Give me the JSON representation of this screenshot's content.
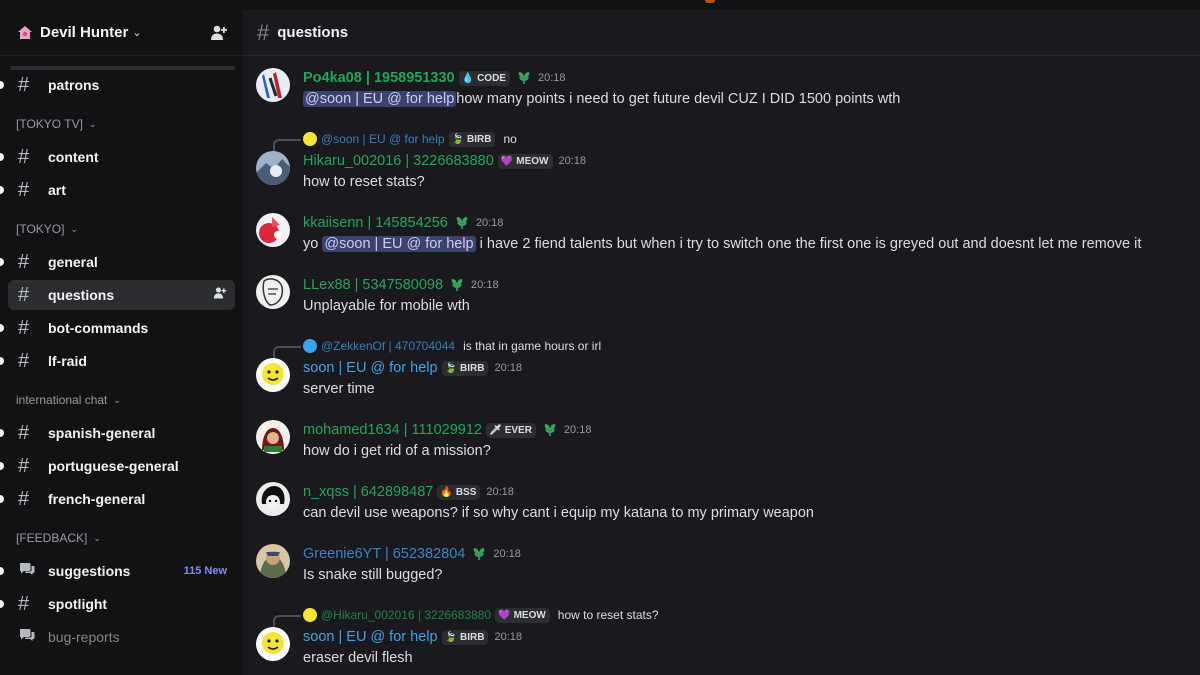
{
  "server": {
    "name": "Devil Hunter"
  },
  "sidebar": {
    "items": [
      {
        "type": "channel",
        "name": "patrons",
        "unread": true
      },
      {
        "type": "category",
        "name": "[TOKYO TV]"
      },
      {
        "type": "channel",
        "name": "content",
        "unread": true
      },
      {
        "type": "channel",
        "name": "art",
        "unread": true
      },
      {
        "type": "category",
        "name": "[TOKYO]"
      },
      {
        "type": "channel",
        "name": "general",
        "unread": true
      },
      {
        "type": "channel",
        "name": "questions",
        "active": true
      },
      {
        "type": "channel",
        "name": "bot-commands",
        "unread": true
      },
      {
        "type": "channel",
        "name": "lf-raid",
        "unread": true
      },
      {
        "type": "category",
        "name": "international chat"
      },
      {
        "type": "channel",
        "name": "spanish-general",
        "unread": true
      },
      {
        "type": "channel",
        "name": "portuguese-general",
        "unread": true
      },
      {
        "type": "channel",
        "name": "french-general",
        "unread": true
      },
      {
        "type": "category",
        "name": "[FEEDBACK]"
      },
      {
        "type": "forum",
        "name": "suggestions",
        "unread": true,
        "badge": "115 New"
      },
      {
        "type": "channel",
        "name": "spotlight",
        "unread": true
      },
      {
        "type": "forum",
        "name": "bug-reports",
        "muted": true
      }
    ]
  },
  "channel": {
    "name": "questions"
  },
  "messages": [
    {
      "user": "Po4ka08 | 1958951330",
      "name_color": "#23a55a",
      "tag": {
        "icon": "💧",
        "text": "CODE"
      },
      "leaf": true,
      "time": "20:18",
      "mention": "@soon | EU @ for help",
      "text": "how many points i need to get future devil CUZ I DID 1500 points wth",
      "avatar": "avatar-po4ka"
    },
    {
      "reply": {
        "name": "@soon | EU @ for help",
        "tag": "BIRB",
        "text": "no"
      },
      "user": "Hikaru_002016 | 3226683880",
      "name_color": "#23a55a",
      "tag": {
        "icon": "💜",
        "text": "MEOW"
      },
      "time": "20:18",
      "text": "how to reset stats?",
      "avatar": "avatar-hikaru"
    },
    {
      "user": "kkaiisenn | 145854256",
      "name_color": "#23a55a",
      "leaf": true,
      "time": "20:18",
      "text_before": "yo ",
      "mention": "@soon | EU @ for help",
      "text": " i have 2 fiend talents but when i try to switch one the first one is greyed out and doesnt let me remove it",
      "avatar": "avatar-kkaiisenn"
    },
    {
      "user": "LLex88 | 5347580098",
      "name_color": "#23a55a",
      "leaf": true,
      "time": "20:18",
      "text": "Unplayable for mobile wth",
      "avatar": "avatar-llex"
    },
    {
      "reply": {
        "name": "@ZekkenOf | 470704044",
        "text": "is that in game hours or irl"
      },
      "user": "soon | EU @ for help",
      "name_color": "#3ba3e8",
      "tag": {
        "icon": "🍃",
        "text": "BIRB"
      },
      "time": "20:18",
      "text": "server time",
      "avatar": "avatar-soon"
    },
    {
      "user": "mohamed1634 | 111029912",
      "name_color": "#23a55a",
      "tag": {
        "icon": "🗡",
        "text": "EVER"
      },
      "leaf": true,
      "time": "20:18",
      "text": "how do i get rid of a mission?",
      "avatar": "avatar-mohamed"
    },
    {
      "user": "n_xqss | 642898487",
      "name_color": "#23a55a",
      "tag": {
        "icon": "🔥",
        "text": "BSS"
      },
      "time": "20:18",
      "text": "can devil use weapons? if so why cant i equip my katana to my primary weapon",
      "avatar": "avatar-nxqss"
    },
    {
      "user": "Greenie6YT | 652382804",
      "name_color": "#3b82c6",
      "leaf": true,
      "time": "20:18",
      "text": "Is snake still bugged?",
      "avatar": "avatar-greenie"
    },
    {
      "reply": {
        "name": "@Hikaru_002016 | 3226683880",
        "tag": "MEOW",
        "text": "how to reset stats?"
      },
      "user": "soon | EU @ for help",
      "name_color": "#3ba3e8",
      "tag": {
        "icon": "🍃",
        "text": "BIRB"
      },
      "time": "20:18",
      "text": "eraser devil flesh",
      "avatar": "avatar-soon"
    }
  ],
  "colors": {
    "accent": "#5865f2",
    "unread_badge": "#7d8cf5",
    "mention_bg": "#3c4270"
  }
}
